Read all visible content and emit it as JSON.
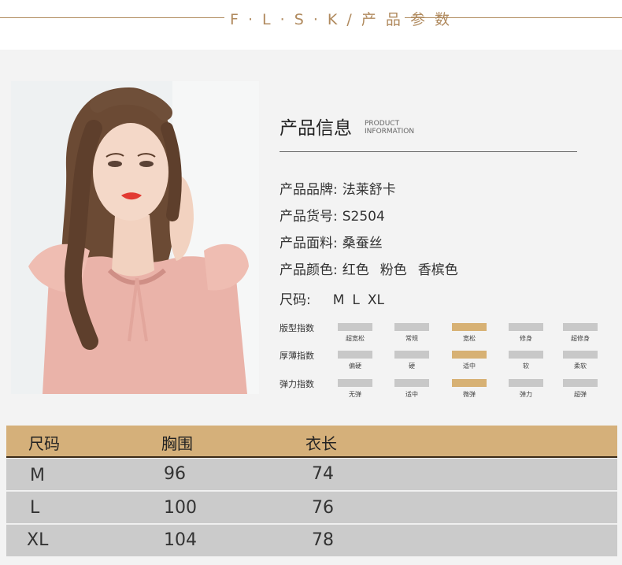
{
  "header": {
    "title": "F · L · S · K / 产 品 参 数"
  },
  "info": {
    "title": "产品信息",
    "subtitle_line1": "PRODUCT",
    "subtitle_line2": "INFORMATION",
    "brand_label": "产品品牌:",
    "brand_value": "法莱舒卡",
    "sku_label": "产品货号:",
    "sku_value": "S2504",
    "fabric_label": "产品面料:",
    "fabric_value": "桑蚕丝",
    "color_label": "产品颜色:",
    "colors": [
      "红色",
      "粉色",
      "香槟色"
    ],
    "size_label": "尺码:",
    "sizes": [
      "M",
      "L",
      "XL"
    ]
  },
  "indices": [
    {
      "label": "版型指数",
      "options": [
        "超宽松",
        "常规",
        "宽松",
        "修身",
        "超修身"
      ],
      "selected_index": 2
    },
    {
      "label": "厚薄指数",
      "options": [
        "偏硬",
        "硬",
        "适中",
        "软",
        "柔软"
      ],
      "selected_index": 2
    },
    {
      "label": "弹力指数",
      "options": [
        "无弹",
        "适中",
        "微弹",
        "弹力",
        "超弹"
      ],
      "selected_index": 2
    }
  ],
  "size_table": {
    "headers": [
      "尺码",
      "胸围",
      "衣长"
    ],
    "rows": [
      [
        "M",
        "96",
        "74"
      ],
      [
        "L",
        "100",
        "76"
      ],
      [
        "XL",
        "104",
        "78"
      ]
    ]
  },
  "colors": {
    "accent": "#d7b174",
    "header_line": "#b08a5e",
    "row_bg": "#cbcbcb"
  }
}
